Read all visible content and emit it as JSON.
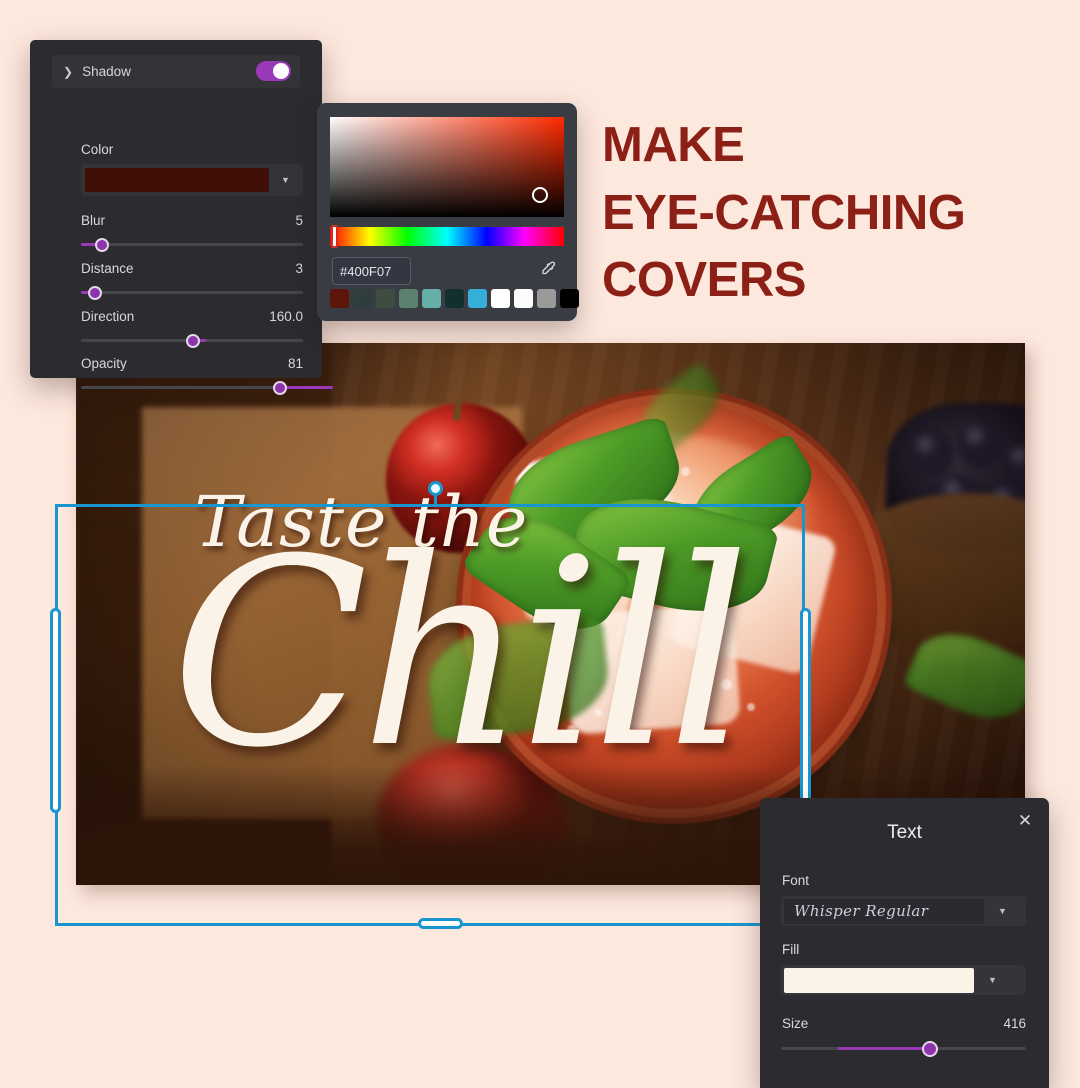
{
  "page": {
    "background_color": "#FDE8DE",
    "accent_purple": "#9A39B8",
    "selection_blue": "#1896CF",
    "headline_color": "#8C2016"
  },
  "headline": {
    "line1": "MAKE",
    "line2": "EYE-CATCHING",
    "line3": "COVERS"
  },
  "shadow_panel": {
    "section_title": "Shadow",
    "chevron_icon": "chevron-down-icon",
    "toggle_on": "true",
    "color_label": "Color",
    "color_value": "#400F07",
    "dropdown_caret": "▼",
    "sliders": [
      {
        "label": "Blur",
        "value": "5",
        "percent": 7
      },
      {
        "label": "Distance",
        "value": "3",
        "percent": 5
      },
      {
        "label": "Direction",
        "value": "160.0",
        "percent": 45
      },
      {
        "label": "Opacity",
        "value": "81",
        "percent": 81
      }
    ]
  },
  "color_picker": {
    "hex_value": "#400F07",
    "eyedropper_icon": "eyedropper-icon",
    "hue_position_percent": 1,
    "sv_cursor": {
      "x_percent": 93,
      "y_percent": 88
    },
    "swatches": [
      "#5E160B",
      "#2E3D3D",
      "#3D4D3F",
      "#5B8171",
      "#66AFA8",
      "#12312E",
      "#36AEDA",
      "#FFFFFF",
      "#FCFCFC",
      "#9A9A9A",
      "#000000"
    ]
  },
  "text_panel": {
    "title": "Text",
    "close_icon": "close-icon",
    "font_label": "Font",
    "font_value": "Whisper Regular",
    "fill_label": "Fill",
    "fill_value": "#FBF3E7",
    "size_label": "Size",
    "size_value": "416",
    "size_percent": 60,
    "dropdown_caret": "▼"
  },
  "canvas": {
    "cover_text_line1": "Taste the",
    "cover_text_line2": "Chill",
    "rotation_handle_icon": "rotate-handle-icon"
  }
}
